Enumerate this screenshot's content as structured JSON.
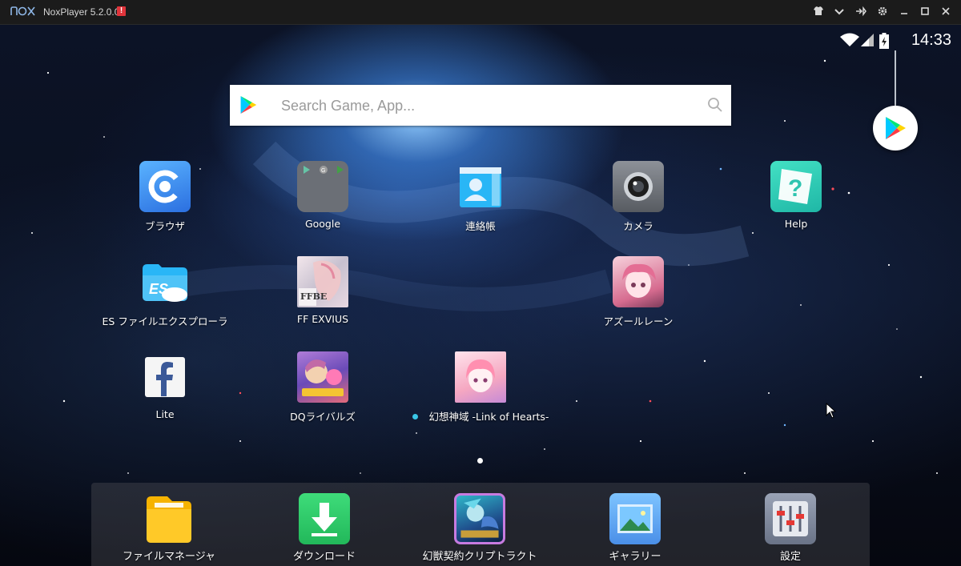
{
  "window": {
    "title": "NoxPlayer 5.2.0.0",
    "badge": "!",
    "logo": "nox-logo",
    "controls": [
      "shirt-icon",
      "chevron-down-icon",
      "pin-icon",
      "gear-icon",
      "minimize-icon",
      "maximize-icon",
      "close-icon"
    ]
  },
  "status_bar": {
    "time": "14:33",
    "icons": [
      "wifi-icon",
      "signal-icon",
      "battery-charging-icon"
    ]
  },
  "search": {
    "placeholder": "Search Game, App..."
  },
  "apps": [
    {
      "label": "ブラウザ",
      "icon": "browser-icon"
    },
    {
      "label": "Google",
      "icon": "google-folder-icon"
    },
    {
      "label": "連絡帳",
      "icon": "contacts-icon"
    },
    {
      "label": "カメラ",
      "icon": "camera-icon"
    },
    {
      "label": "Help",
      "icon": "help-icon"
    },
    {
      "label": "ES ファイルエクスプローラ",
      "icon": "es-file-explorer-icon"
    },
    {
      "label": "FF EXVIUS",
      "icon": "ff-exvius-icon"
    },
    {
      "label": "アズールレーン",
      "icon": "azur-lane-icon"
    },
    {
      "label": "Lite",
      "icon": "facebook-lite-icon"
    },
    {
      "label": "DQライバルズ",
      "icon": "dq-rivals-icon"
    },
    {
      "label": "幻想神域 -Link of Hearts-",
      "icon": "genso-shiniki-icon",
      "new": true
    }
  ],
  "dock": [
    {
      "label": "ファイルマネージャ",
      "icon": "file-manager-icon"
    },
    {
      "label": "ダウンロード",
      "icon": "download-icon"
    },
    {
      "label": "幻獣契約クリプトラクト",
      "icon": "cryptract-icon"
    },
    {
      "label": "ギャラリー",
      "icon": "gallery-icon"
    },
    {
      "label": "設定",
      "icon": "settings-icon"
    }
  ],
  "ff_icon_text": "FFBE",
  "colors": {
    "titlebar": "#1b1b1b",
    "badge": "#e0343b",
    "new_dot": "#39c6e6"
  }
}
